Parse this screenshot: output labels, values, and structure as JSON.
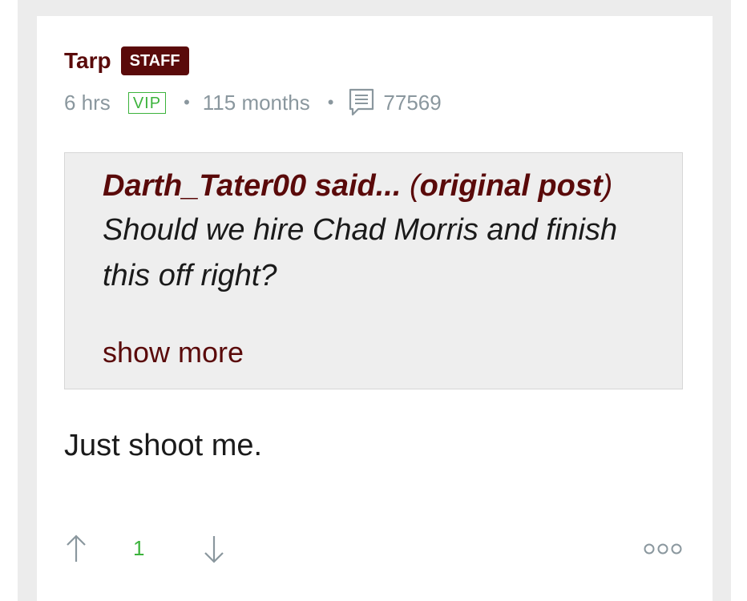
{
  "post": {
    "author": "Tarp",
    "role_badge": "STAFF",
    "time_ago": "6 hrs",
    "membership_badge": "VIP",
    "member_duration": "115 months",
    "separator": "•",
    "post_count": "77569",
    "quote": {
      "author_said": "Darth_Tater00 said...",
      "original_post_label": "original post",
      "open_paren": "(",
      "close_paren": ")",
      "text": "Should we hire Chad Morris and finish this off right?",
      "show_more": "show more"
    },
    "body": "Just shoot me.",
    "votes": {
      "score": "1"
    }
  },
  "colors": {
    "brand": "#5a0a0a",
    "vip_green": "#3cb33c",
    "meta_gray": "#8a979e"
  },
  "icons": {
    "comment": "comment-icon",
    "upvote": "arrow-up-icon",
    "downvote": "arrow-down-icon",
    "more": "more-options-icon"
  }
}
